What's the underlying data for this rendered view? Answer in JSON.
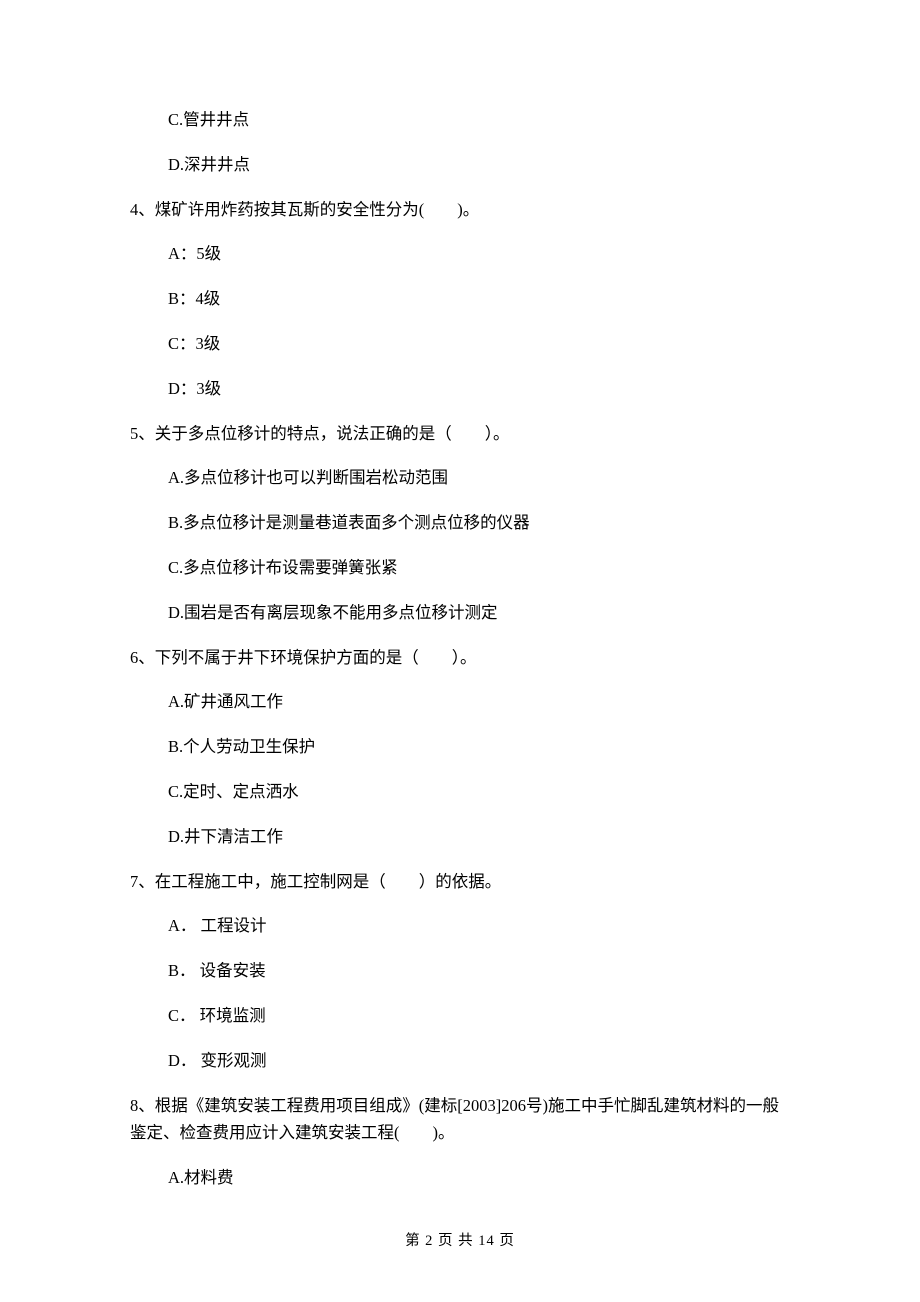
{
  "orphan_options": [
    "C.管井井点",
    "D.深井井点"
  ],
  "questions": [
    {
      "stem": "4、煤矿许用炸药按其瓦斯的安全性分为(　　)。",
      "options": [
        "A：5级",
        "B：4级",
        "C：3级",
        "D：3级"
      ]
    },
    {
      "stem": "5、关于多点位移计的特点，说法正确的是（　　）。",
      "options": [
        "A.多点位移计也可以判断围岩松动范围",
        "B.多点位移计是测量巷道表面多个测点位移的仪器",
        "C.多点位移计布设需要弹簧张紧",
        "D.围岩是否有离层现象不能用多点位移计测定"
      ]
    },
    {
      "stem": "6、下列不属于井下环境保护方面的是（　　）。",
      "options": [
        "A.矿井通风工作",
        "B.个人劳动卫生保护",
        "C.定时、定点洒水",
        "D.井下清洁工作"
      ]
    },
    {
      "stem": "7、在工程施工中，施工控制网是（　　）的依据。",
      "options": [
        "A． 工程设计",
        "B． 设备安装",
        "C． 环境监测",
        "D． 变形观测"
      ]
    },
    {
      "stem_lines": [
        "8、根据《建筑安装工程费用项目组成》(建标[2003]206号)施工中手忙脚乱建筑材料的一般",
        "鉴定、检查费用应计入建筑安装工程(　　)。"
      ],
      "options": [
        "A.材料费"
      ]
    }
  ],
  "footer": "第 2 页 共 14 页"
}
